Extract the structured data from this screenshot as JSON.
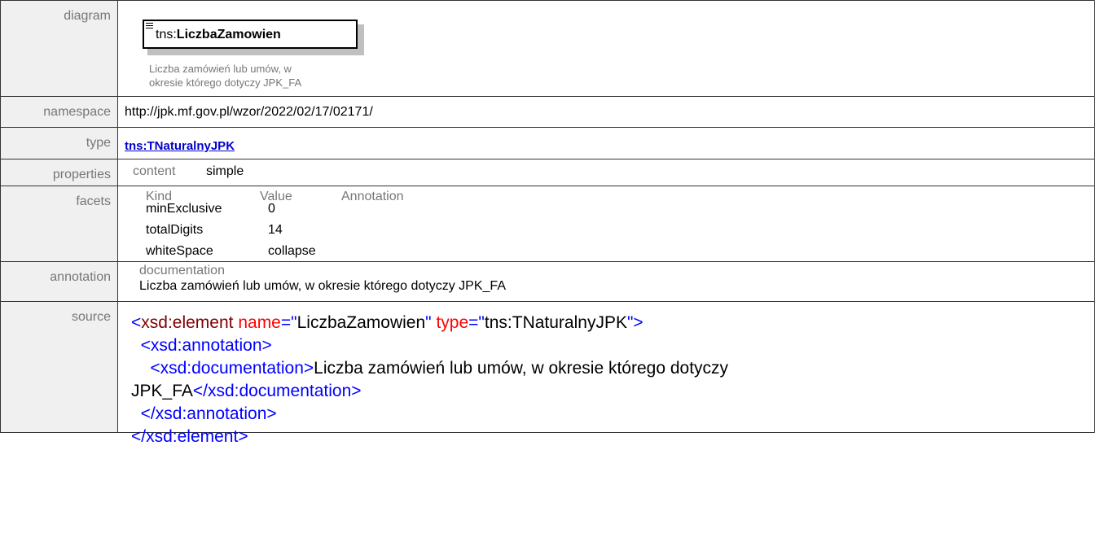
{
  "labels": {
    "diagram": "diagram",
    "namespace": "namespace",
    "type": "type",
    "properties": "properties",
    "facets": "facets",
    "annotation": "annotation",
    "source": "source"
  },
  "diagram": {
    "prefix": "tns:",
    "name": "LiczbaZamowien",
    "doc_line1": "Liczba zamówień lub umów, w",
    "doc_line2": "okresie którego dotyczy JPK_FA"
  },
  "namespace": "http://jpk.mf.gov.pl/wzor/2022/02/17/02171/",
  "type_link": "tns:TNaturalnyJPK",
  "properties": {
    "key": "content",
    "value": "simple"
  },
  "facets": {
    "headers": [
      "Kind",
      "Value",
      "Annotation"
    ],
    "rows": [
      {
        "kind": "minExclusive",
        "value": "0"
      },
      {
        "kind": "totalDigits",
        "value": "14"
      },
      {
        "kind": "whiteSpace",
        "value": "collapse"
      }
    ]
  },
  "annotation": {
    "header": "documentation",
    "text": "Liczba zamówień lub umów, w okresie którego dotyczy JPK_FA"
  },
  "source": {
    "l1_open": "<",
    "l1_tag": "xsd:element",
    "l1_attr1": " name",
    "l1_eq1": "=\"",
    "l1_val1": "LiczbaZamowien",
    "l1_q1": "\"",
    "l1_attr2": " type",
    "l1_eq2": "=\"",
    "l1_val2": "tns:TNaturalnyJPK",
    "l1_close": "\">",
    "l2": "  <xsd:annotation>",
    "l3_open": "    <xsd:documentation>",
    "l3_text": "Liczba zamówień lub umów, w okresie którego dotyczy",
    "l4_text": "JPK_FA",
    "l4_close": "</xsd:documentation>",
    "l5": "  </xsd:annotation>",
    "l6": "</xsd:element>"
  },
  "colors": {
    "tag": "#0000ff",
    "attr_name": "#ff0000",
    "element_name": "#800000",
    "link": "#0000cc",
    "label_gray": "#777777"
  }
}
